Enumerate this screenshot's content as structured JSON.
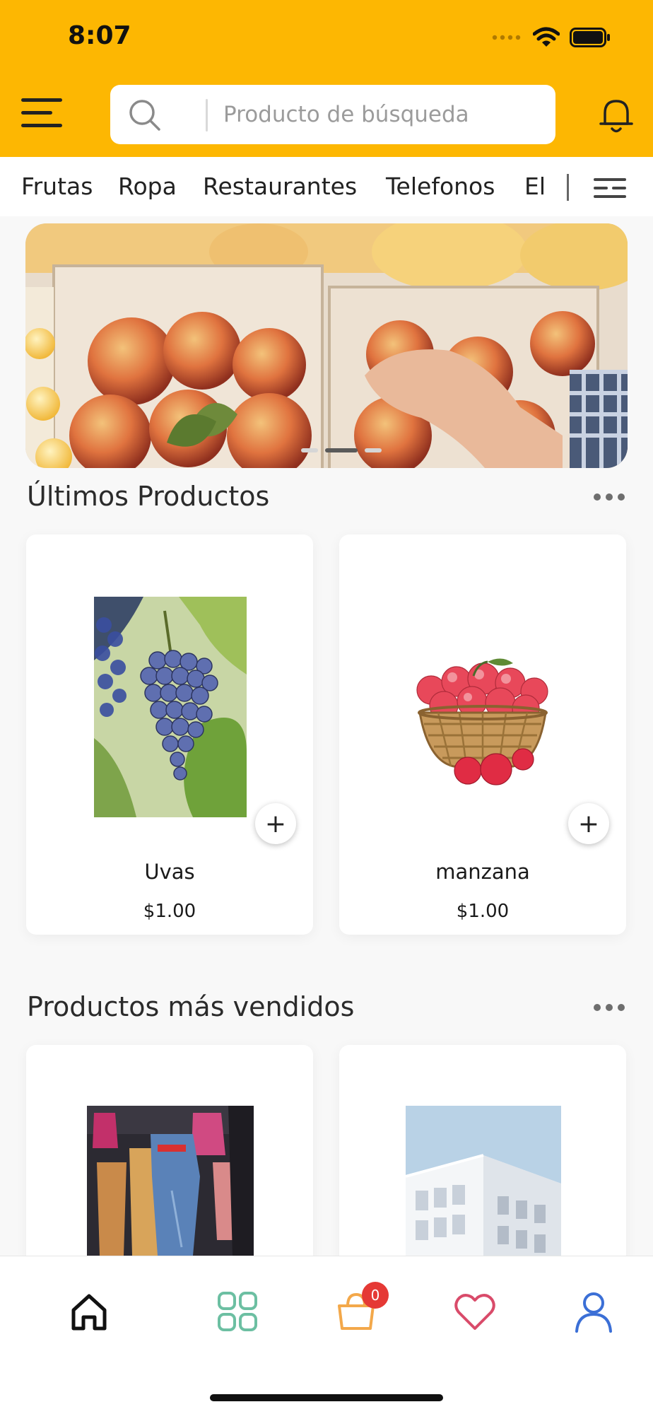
{
  "status_bar": {
    "time": "8:07"
  },
  "header": {
    "search": {
      "placeholder": "Producto de búsqueda"
    },
    "accent_color": "#FDB702"
  },
  "categories": [
    "Frutas",
    "Ropa",
    "Restaurantes",
    "Telefonos",
    "El"
  ],
  "banner": {
    "dots": 3,
    "active_dot": 1
  },
  "latest": {
    "title": "Últimos Productos",
    "products": [
      {
        "name": "Uvas",
        "price": "$1.00",
        "image": "grapes"
      },
      {
        "name": "manzana",
        "price": "$1.00",
        "image": "apple-basket"
      }
    ]
  },
  "best_sellers": {
    "title": "Productos más vendidos",
    "products": [
      {
        "image": "clothing-store"
      },
      {
        "image": "building"
      }
    ]
  },
  "bottom_nav": {
    "items": [
      "home-icon",
      "grid-icon",
      "cart-icon",
      "heart-icon",
      "user-icon"
    ],
    "cart_count": "0"
  }
}
